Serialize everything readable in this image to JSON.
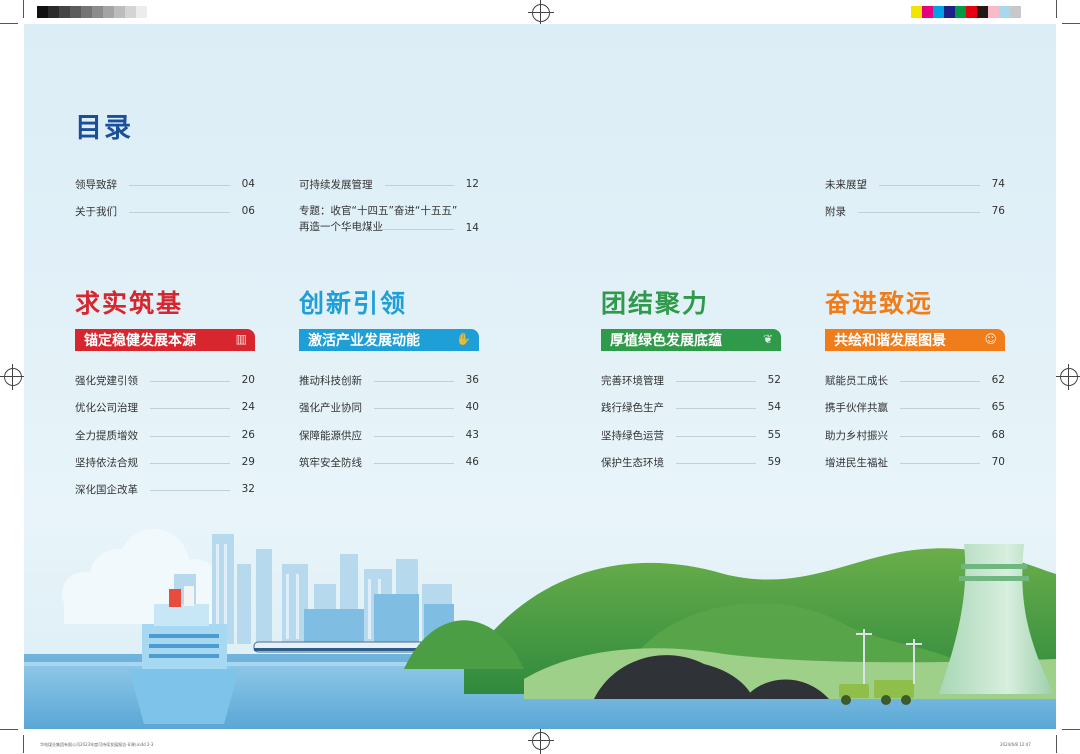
{
  "toc": {
    "title": "目录",
    "top_left": [
      {
        "label": "领导致辞",
        "page": "04"
      },
      {
        "label": "关于我们",
        "page": "06"
      }
    ],
    "top_mid": [
      {
        "label": "可持续发展管理",
        "page": "12"
      },
      {
        "label_line1": "专题：收官“十四五”奋进“十五五”",
        "label_line2": "再造一个华电煤业",
        "page": "14"
      }
    ],
    "top_right": [
      {
        "label": "未来展望",
        "page": "74"
      },
      {
        "label": "附录",
        "page": "76"
      }
    ]
  },
  "chapters": [
    {
      "title": "求实筑基",
      "subtitle": "锚定稳健发展本源",
      "color": "#d7262e",
      "items": [
        {
          "label": "强化党建引领",
          "page": "20"
        },
        {
          "label": "优化公司治理",
          "page": "24"
        },
        {
          "label": "全力提质增效",
          "page": "26"
        },
        {
          "label": "坚持依法合规",
          "page": "29"
        },
        {
          "label": "深化国企改革",
          "page": "32"
        }
      ]
    },
    {
      "title": "创新引领",
      "subtitle": "激活产业发展动能",
      "color": "#1e9fd8",
      "items": [
        {
          "label": "推动科技创新",
          "page": "36"
        },
        {
          "label": "强化产业协同",
          "page": "40"
        },
        {
          "label": "保障能源供应",
          "page": "43"
        },
        {
          "label": "筑牢安全防线",
          "page": "46"
        }
      ]
    },
    {
      "title": "团结聚力",
      "subtitle": "厚植绿色发展底蕴",
      "color": "#2e9a4a",
      "items": [
        {
          "label": "完善环境管理",
          "page": "52"
        },
        {
          "label": "践行绿色生产",
          "page": "54"
        },
        {
          "label": "坚持绿色运营",
          "page": "55"
        },
        {
          "label": "保护生态环境",
          "page": "59"
        }
      ]
    },
    {
      "title": "奋进致远",
      "subtitle": "共绘和谐发展图景",
      "color": "#f07d1a",
      "items": [
        {
          "label": "赋能员工成长",
          "page": "62"
        },
        {
          "label": "携手伙伴共赢",
          "page": "65"
        },
        {
          "label": "助力乡村振兴",
          "page": "68"
        },
        {
          "label": "增进民生福祉",
          "page": "70"
        }
      ]
    }
  ],
  "print_marks": {
    "slug_left": "华电煤业集团有限公司2023年度可持续发展报告-印刷.indd 2-3",
    "slug_right": "2024/6/8 12:47",
    "gray_swatches": [
      "#111111",
      "#2b2b2b",
      "#444444",
      "#5c5c5c",
      "#747474",
      "#8c8c8c",
      "#a4a4a4",
      "#bcbcbc",
      "#d4d4d4",
      "#ececec"
    ],
    "color_swatches": [
      "#f2e600",
      "#e4007f",
      "#00a0e9",
      "#1d2088",
      "#009944",
      "#e60012",
      "#231815",
      "#f8b9c9",
      "#a8d8ef",
      "#c8c8c8"
    ]
  }
}
